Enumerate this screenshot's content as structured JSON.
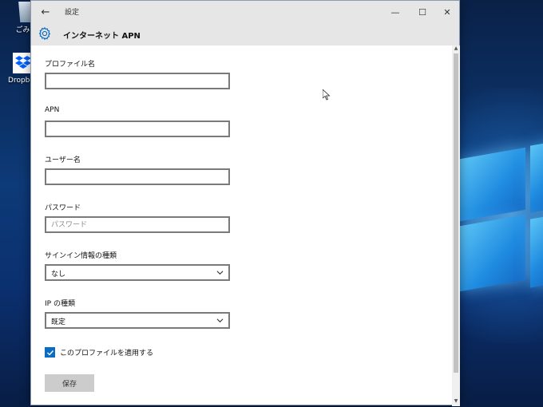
{
  "desktop": {
    "icons": [
      {
        "label": "ごみ箱",
        "icon": "recycle-bin-icon"
      },
      {
        "label": "Dropbox",
        "icon": "dropbox-icon"
      }
    ]
  },
  "window": {
    "title": "設定",
    "controls": {
      "minimize": "—",
      "maximize": "☐",
      "close": "✕"
    }
  },
  "header": {
    "icon": "gear-icon",
    "title": "インターネット APN"
  },
  "form": {
    "profile_name": {
      "label": "プロファイル名",
      "value": "",
      "placeholder": ""
    },
    "apn": {
      "label": "APN",
      "value": "",
      "placeholder": ""
    },
    "username": {
      "label": "ユーザー名",
      "value": "",
      "placeholder": ""
    },
    "password": {
      "label": "パスワード",
      "value": "",
      "placeholder": "パスワード"
    },
    "signin_type": {
      "label": "サインイン情報の種類",
      "selected": "なし"
    },
    "ip_type": {
      "label": "IP の種類",
      "selected": "既定"
    },
    "apply_profile": {
      "label": "このプロファイルを適用する",
      "checked": true
    },
    "save_label": "保存"
  },
  "colors": {
    "accent": "#0a6cc4",
    "titlebar": "#e6e6e6",
    "button": "#cccccc"
  }
}
